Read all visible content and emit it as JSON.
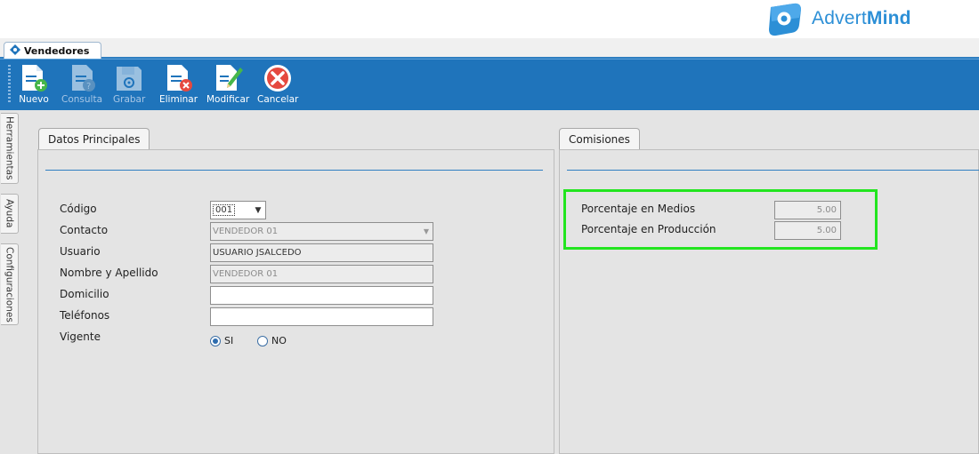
{
  "brand": {
    "name_regular": "Advert",
    "name_bold": "Mind",
    "color": "#2c8fd6"
  },
  "document_tab": {
    "label": "Vendedores"
  },
  "toolbar": {
    "buttons": [
      {
        "label": "Nuevo",
        "icon": "new-document-icon",
        "enabled": true
      },
      {
        "label": "Consulta",
        "icon": "query-document-icon",
        "enabled": false
      },
      {
        "label": "Grabar",
        "icon": "save-disk-icon",
        "enabled": false
      },
      {
        "label": "Eliminar",
        "icon": "delete-document-icon",
        "enabled": true
      },
      {
        "label": "Modificar",
        "icon": "edit-document-icon",
        "enabled": true
      },
      {
        "label": "Cancelar",
        "icon": "cancel-icon",
        "enabled": true
      }
    ]
  },
  "side_tabs": [
    "Herramientas",
    "Ayuda",
    "Configuraciones"
  ],
  "datos_principales": {
    "tab_label": "Datos Principales",
    "fields": {
      "codigo": {
        "label": "Código",
        "value": "001"
      },
      "contacto": {
        "label": "Contacto",
        "value": "VENDEDOR 01"
      },
      "usuario": {
        "label": "Usuario",
        "value": "USUARIO JSALCEDO"
      },
      "nombre": {
        "label": "Nombre y Apellido",
        "value": "VENDEDOR 01"
      },
      "domicilio": {
        "label": "Domicilio",
        "value": ""
      },
      "telefonos": {
        "label": "Teléfonos",
        "value": ""
      },
      "vigente": {
        "label": "Vigente",
        "options": [
          "SI",
          "NO"
        ],
        "selected": "SI"
      }
    }
  },
  "comisiones": {
    "tab_label": "Comisiones",
    "fields": {
      "medios": {
        "label": "Porcentaje en Medios",
        "value": "5.00"
      },
      "produccion": {
        "label": "Porcentaje en Producción",
        "value": "5.00"
      }
    }
  },
  "colors": {
    "toolbar": "#1f74bb",
    "accent_rule": "#2f7fc1",
    "highlight": "#22e51f"
  }
}
